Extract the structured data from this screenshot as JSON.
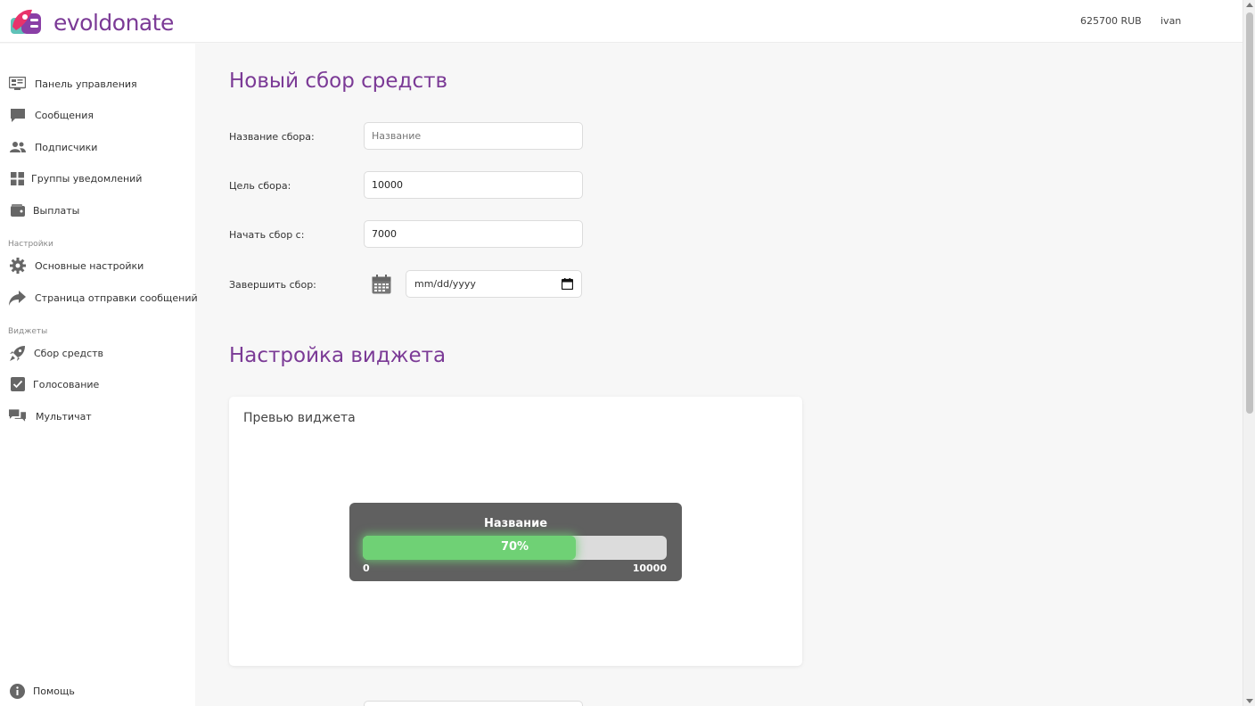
{
  "header": {
    "logo_text": "evoldonate",
    "balance": "625700 RUB",
    "username": "ivan"
  },
  "sidebar": {
    "items": [
      {
        "label": "Панель управления",
        "icon": "dashboard-icon"
      },
      {
        "label": "Сообщения",
        "icon": "message-icon"
      },
      {
        "label": "Подписчики",
        "icon": "users-icon"
      },
      {
        "label": "Группы уведомлений",
        "icon": "grid-icon"
      },
      {
        "label": "Выплаты",
        "icon": "wallet-icon"
      }
    ],
    "settings_title": "Настройки",
    "settings_items": [
      {
        "label": "Основные настройки",
        "icon": "gear-icon"
      },
      {
        "label": "Страница отправки сообщений",
        "icon": "share-icon"
      }
    ],
    "widgets_title": "Виджеты",
    "widget_items": [
      {
        "label": "Сбор средств",
        "icon": "rocket-icon"
      },
      {
        "label": "Голосование",
        "icon": "checkbox-icon"
      },
      {
        "label": "Мультичат",
        "icon": "chat-icon"
      }
    ],
    "help": {
      "label": "Помощь",
      "icon": "info-icon"
    }
  },
  "form": {
    "title": "Новый сбор средств",
    "name_label": "Название сбора:",
    "name_placeholder": "Название",
    "goal_label": "Цель сбора:",
    "goal_value": "10000",
    "start_label": "Начать сбор с:",
    "start_value": "7000",
    "end_label": "Завершить сбор:",
    "end_placeholder": "mm/dd/yyyy"
  },
  "widget_settings": {
    "title": "Настройка виджета",
    "preview_title": "Превью виджета",
    "widget": {
      "name": "Название",
      "percent_label": "70%",
      "progress": 0.7,
      "min": "0",
      "max": "10000"
    }
  },
  "colors": {
    "accent": "#7b3a96",
    "progress": "#6fd175",
    "widget_bg": "#606060"
  }
}
